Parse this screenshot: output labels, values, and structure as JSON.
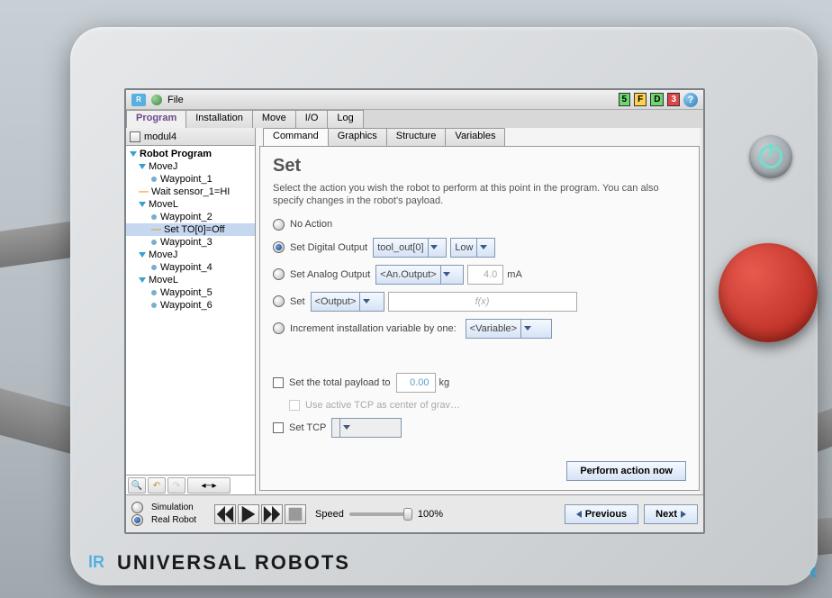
{
  "titlebar": {
    "file_label": "File"
  },
  "status": {
    "c1": "5",
    "c2": "F",
    "c3": "D",
    "c4": "3"
  },
  "main_tabs": [
    "Program",
    "Installation",
    "Move",
    "I/O",
    "Log"
  ],
  "program_name": "modul4",
  "tree": {
    "root": "Robot Program",
    "items": [
      {
        "label": "MoveJ",
        "type": "move"
      },
      {
        "label": "Waypoint_1",
        "type": "wp"
      },
      {
        "label": "Wait sensor_1=HI",
        "type": "wait"
      },
      {
        "label": "MoveL",
        "type": "move"
      },
      {
        "label": "Waypoint_2",
        "type": "wp"
      },
      {
        "label": "Set TO[0]=Off",
        "type": "set",
        "selected": true
      },
      {
        "label": "Waypoint_3",
        "type": "wp"
      },
      {
        "label": "MoveJ",
        "type": "move"
      },
      {
        "label": "Waypoint_4",
        "type": "wp"
      },
      {
        "label": "MoveL",
        "type": "move"
      },
      {
        "label": "Waypoint_5",
        "type": "wp"
      },
      {
        "label": "Waypoint_6",
        "type": "wp"
      }
    ]
  },
  "sub_tabs": [
    "Command",
    "Graphics",
    "Structure",
    "Variables"
  ],
  "panel": {
    "title": "Set",
    "description": "Select the action you wish the robot to perform at this point in the program. You can also specify changes in the robot's payload.",
    "opt_none": "No Action",
    "opt_digital": "Set Digital Output",
    "digital_out": "tool_out[0]",
    "digital_val": "Low",
    "opt_analog": "Set Analog Output",
    "analog_out": "<An.Output>",
    "analog_val": "4.0",
    "analog_unit": "mA",
    "opt_set": "Set",
    "set_out": "<Output>",
    "fx_placeholder": "f(x)",
    "opt_increment": "Increment installation variable by one:",
    "inc_var": "<Variable>",
    "chk_payload": "Set the total payload to",
    "payload_val": "0.00",
    "payload_unit": "kg",
    "chk_tcp_grav": "Use active TCP as center of grav…",
    "chk_tcp": "Set TCP",
    "perform_btn": "Perform action now"
  },
  "footer": {
    "sim": "Simulation",
    "real": "Real Robot",
    "speed_label": "Speed",
    "speed_val": "100%",
    "prev": "Previous",
    "next": "Next"
  },
  "brand": "UNIVERSAL ROBOTS"
}
